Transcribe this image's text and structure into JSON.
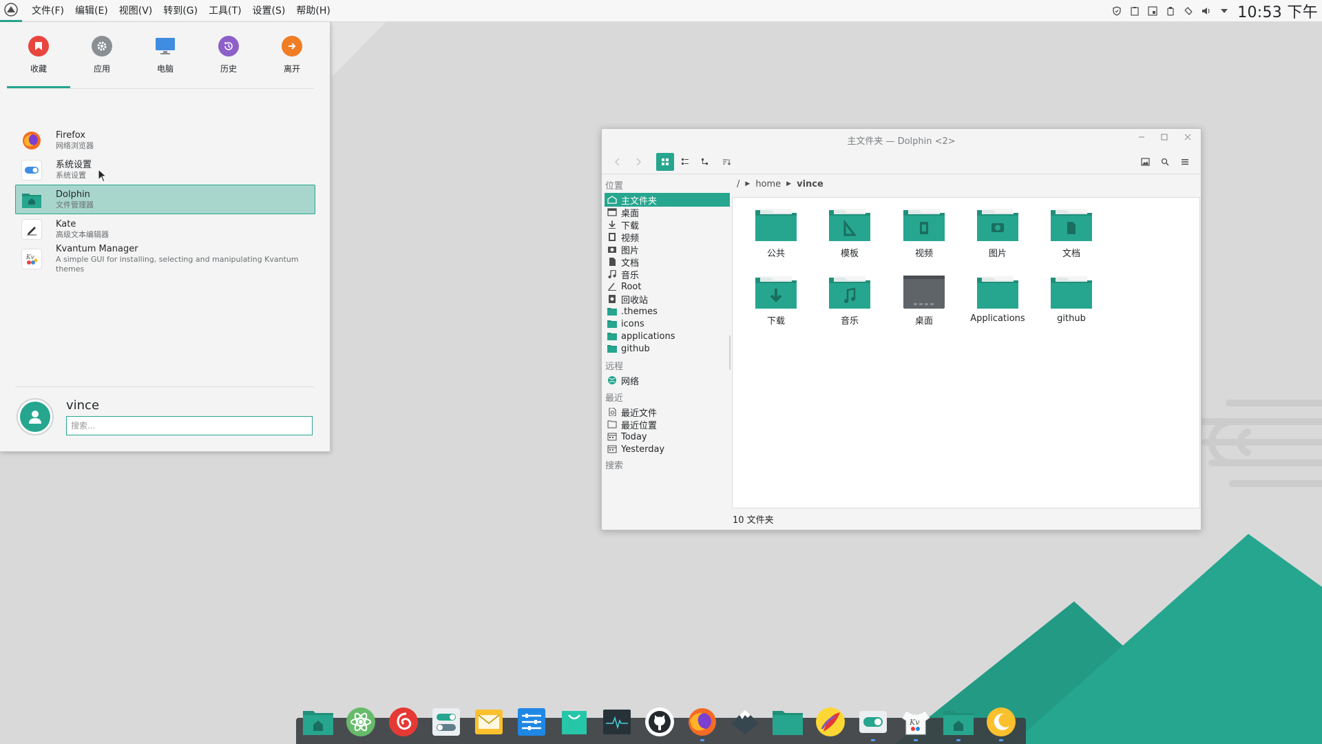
{
  "menubar": {
    "items": [
      "文件(F)",
      "编辑(E)",
      "视图(V)",
      "转到(G)",
      "工具(T)",
      "设置(S)",
      "帮助(H)"
    ]
  },
  "tray": {
    "icons": [
      "shield-icon",
      "clipboard-icon",
      "notes-icon",
      "device-icon",
      "sync-icon",
      "volume-icon",
      "arrow-down-icon"
    ],
    "clock": "10:53 下午"
  },
  "launcher": {
    "tabs": [
      {
        "label": "收藏",
        "icon": "bookmark-icon",
        "color": "#e8453c"
      },
      {
        "label": "应用",
        "icon": "gear-icon",
        "color": "#8a8f94"
      },
      {
        "label": "电脑",
        "icon": "monitor-icon",
        "color": "#3f8ce0"
      },
      {
        "label": "历史",
        "icon": "history-icon",
        "color": "#8d60c9"
      },
      {
        "label": "离开",
        "icon": "arrow-right-icon",
        "color": "#f07c23"
      }
    ],
    "apps": [
      {
        "name": "Firefox",
        "desc": "网络浏览器"
      },
      {
        "name": "系统设置",
        "desc": "系统设置"
      },
      {
        "name": "Dolphin",
        "desc": "文件管理器"
      },
      {
        "name": "Kate",
        "desc": "高级文本编辑器"
      },
      {
        "name": "Kvantum Manager",
        "desc": "A simple GUI for installing, selecting and manipulating Kvantum themes"
      }
    ],
    "username": "vince",
    "search_placeholder": "搜索..."
  },
  "dolphin": {
    "title": "主文件夹 — Dolphin <2>",
    "places_heading": "位置",
    "places": [
      "主文件夹",
      "桌面",
      "下载",
      "视频",
      "图片",
      "文档",
      "音乐",
      "Root",
      "回收站",
      ".themes",
      "icons",
      "applications",
      "github"
    ],
    "remote_heading": "远程",
    "remote": [
      "网络"
    ],
    "recent_heading": "最近",
    "recent": [
      "最近文件",
      "最近位置",
      "Today",
      "Yesterday"
    ],
    "search_heading": "搜索",
    "breadcrumb": [
      "/",
      "home",
      "vince"
    ],
    "files": [
      "公共",
      "模板",
      "视频",
      "图片",
      "文档",
      "下载",
      "音乐",
      "桌面",
      "Applications",
      "github"
    ],
    "status": "10 文件夹"
  },
  "colors": {
    "accent": "#26a68e",
    "folder": "#26a68e",
    "folder_tab": "#1f8f7a"
  },
  "dock": {
    "apps": [
      "home-folder-icon",
      "atom-icon",
      "netease-music-icon",
      "toggle-settings-icon",
      "mail-icon",
      "equalizer-icon",
      "store-icon",
      "system-monitor-icon",
      "github-icon",
      "firefox-icon",
      "inkscape-icon",
      "folder-icon",
      "kde-connect-icon",
      "system-settings-icon",
      "kvantum-icon",
      "dolphin-icon",
      "night-light-icon"
    ]
  }
}
